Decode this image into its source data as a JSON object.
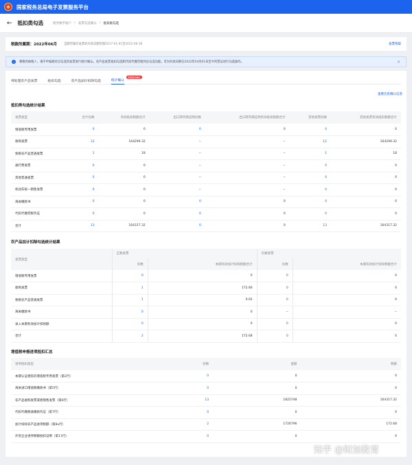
{
  "header": {
    "title": "国家税务总局电子发票服务平台"
  },
  "breadcrumb": {
    "page_title": "抵扣类勾选",
    "items": [
      "税务数字账户",
      "发票勾选确认",
      "抵扣类勾选"
    ]
  },
  "period": {
    "label": "税款所属期：",
    "value": "2022年06月",
    "note": "当期可操作发票的开具日期范围2017-01-01至2022-06-30",
    "link": "发票筛取"
  },
  "info": {
    "text": "尊敬的纳税人，请于申报期对已勾选的发票进行统计确认。农产品发票抵扣勾选和代扣代缴完税凭证勾选功能，可对开具日期在2022年04月01日至今的票证进行勾选操作。"
  },
  "tabs": [
    "待处理农产品发票",
    "抵扣勾选",
    "农产品加计扣除勾选",
    "统计确认"
  ],
  "badge": "申报期请确认",
  "history_link": "查看历史确认信息",
  "table1": {
    "title": "抵扣类勾选统计结果",
    "headers": [
      "发票类型",
      "合计份数",
      "有效抵扣税额合计",
      "出口转内销证明份数",
      "出口转内销证明有效抵扣税额合计",
      "其他发票份数",
      "其他发票有效抵扣税额合计"
    ],
    "rows": [
      [
        "增值税专用发票",
        "0",
        "0",
        "0",
        "0",
        "0",
        "0"
      ],
      [
        "收购发票",
        "12",
        "164299.32",
        "--",
        "--",
        "12",
        "164299.32"
      ],
      [
        "免税农产品普通发票",
        "1",
        "18",
        "--",
        "--",
        "1",
        "18"
      ],
      [
        "通行费发票",
        "0",
        "0",
        "--",
        "--",
        "0",
        "0"
      ],
      [
        "其他普通发票",
        "0",
        "0",
        "--",
        "--",
        "0",
        "0"
      ],
      [
        "机动车统一销售发票",
        "0",
        "0",
        "--",
        "--",
        "0",
        "0"
      ],
      [
        "海关缴款书",
        "0",
        "0",
        "0",
        "0",
        "0",
        "0"
      ],
      [
        "代扣代缴完税凭证",
        "0",
        "0",
        "0",
        "0",
        "0",
        "0"
      ],
      [
        "合计",
        "13",
        "164317.32",
        "0",
        "0",
        "13",
        "164317.32"
      ]
    ]
  },
  "table2": {
    "title": "农产品加计扣除勾选统计结果",
    "group_headers": [
      "发票类型",
      "正数发票",
      "负数发票"
    ],
    "sub_headers": [
      "份数",
      "本期有效加计扣除税额合计",
      "份数",
      "本期有效加计扣除税额合计"
    ],
    "rows": [
      [
        "增值税专用发票",
        "0",
        "0",
        "0",
        "0"
      ],
      [
        "收购发票",
        "1",
        "172.66",
        "0",
        "0"
      ],
      [
        "免税农产品普通发票",
        "1",
        "0.02",
        "0",
        "0"
      ],
      [
        "海关缴款书",
        "0",
        "0",
        "--",
        "--"
      ],
      [
        "录入本期有效加计扣除额",
        "0",
        "0",
        "0",
        "0"
      ],
      [
        "合计",
        "2",
        "172.68",
        "0",
        "0"
      ]
    ]
  },
  "table3": {
    "title": "增值税申报进项抵扣汇总",
    "headers": [
      "进项抵扣类型",
      "份数",
      "金额",
      "税额"
    ],
    "rows": [
      [
        "本期认证相符的增值税专用发票（第2行）",
        "0",
        "0",
        "0"
      ],
      [
        "海关进口增值税缴款书（第5行）",
        "0",
        "0",
        "0"
      ],
      [
        "农产品收购发票或者销售发票（第6行）",
        "13",
        "1825748",
        "164317.32"
      ],
      [
        "代扣代缴税收缴款凭证（第7行）",
        "0",
        "0",
        "0"
      ],
      [
        "加计扣除农产品进项税额（第8a行）",
        "2",
        "1726796",
        "172.68"
      ],
      [
        "外贸企业进项税额抵扣证明（第11行）",
        "0",
        "0",
        "0"
      ]
    ]
  },
  "watermark": "知乎 @财加教育"
}
